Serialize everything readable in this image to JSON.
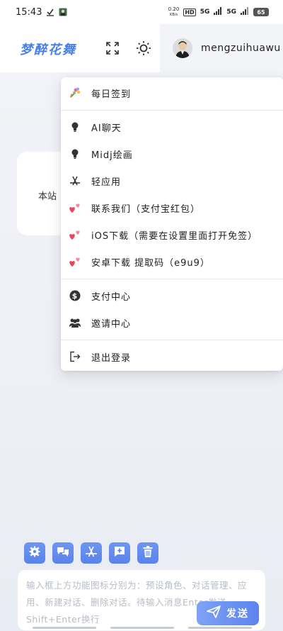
{
  "status_bar": {
    "time": "15:43",
    "speed_value": "0.20",
    "speed_unit": "KB/s",
    "hd_badge": "HD",
    "network_1": "5G",
    "network_2": "5G",
    "battery": "65"
  },
  "header": {
    "brand": "梦醉花舞",
    "username": "mengzuihuawu",
    "icons": [
      "fullscreen-icon",
      "sun-icon"
    ]
  },
  "menu": {
    "items": [
      {
        "label": "每日签到",
        "icon": "bouquet-icon"
      },
      {
        "label": "AI聊天",
        "icon": "lightbulb-icon"
      },
      {
        "label": "Midj绘画",
        "icon": "lightbulb-icon"
      },
      {
        "label": "轻应用",
        "icon": "app-store-icon"
      },
      {
        "label": "联系我们（支付宝红包）",
        "icon": "hearts-icon"
      },
      {
        "label": "iOS下载（需要在设置里面打开免签）",
        "icon": "hearts-icon"
      },
      {
        "label": "安卓下载 提取码（e9u9）",
        "icon": "hearts-icon"
      },
      {
        "label": "支付中心",
        "icon": "dollar-icon"
      },
      {
        "label": "邀请中心",
        "icon": "users-icon"
      },
      {
        "label": "退出登录",
        "icon": "logout-icon"
      }
    ]
  },
  "background_card": {
    "text": "本站"
  },
  "toolbar": {
    "buttons": [
      "settings-icon",
      "chat-bubbles-icon",
      "app-store-icon",
      "add-chat-icon",
      "trash-icon"
    ]
  },
  "input": {
    "placeholder": "输入框上方功能图标分别为：预设角色、对话管理、应用、新建对话、删除对话。待输入消息Enter发送，Shift+Enter换行"
  },
  "send_button": {
    "label": "发送"
  },
  "colors": {
    "accent": "#5b84ef",
    "brand": "#4a7fe8"
  }
}
